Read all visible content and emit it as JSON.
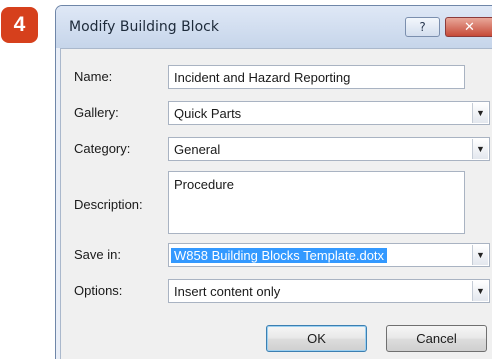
{
  "step_number": "4",
  "dialog": {
    "title": "Modify Building Block",
    "help_label": "?",
    "close_label": "✕",
    "fields": {
      "name": {
        "label": "Name:",
        "value": "Incident and Hazard Reporting"
      },
      "gallery": {
        "label": "Gallery:",
        "value": "Quick Parts"
      },
      "category": {
        "label": "Category:",
        "value": "General"
      },
      "description": {
        "label": "Description:",
        "value": "Procedure"
      },
      "save_in": {
        "label": "Save in:",
        "value": "W858 Building Blocks Template.dotx"
      },
      "options": {
        "label": "Options:",
        "value": "Insert content only"
      }
    },
    "ok_label": "OK",
    "cancel_label": "Cancel"
  },
  "colors": {
    "badge": "#d6401c",
    "selection": "#3399ff",
    "close_button": "#c64a38"
  }
}
